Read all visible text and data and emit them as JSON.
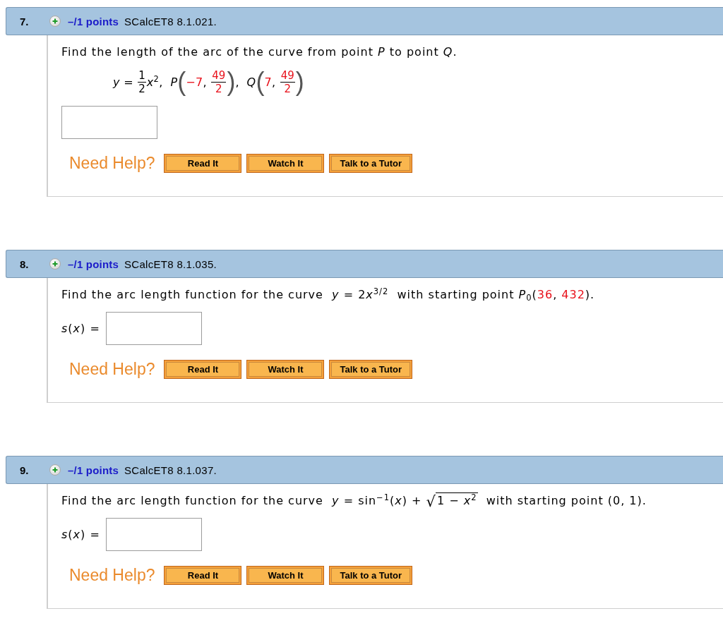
{
  "questions": [
    {
      "number": "7.",
      "points": "–/1 points",
      "source": "SCalcET8 8.1.021.",
      "prompt": [
        {
          "kind": "text",
          "text": "Find the length of the arc of the curve from point *P* to point *Q*."
        }
      ],
      "formula": [
        {
          "kind": "text",
          "text": "*y* = "
        },
        {
          "kind": "frac",
          "num": "1",
          "den": "2"
        },
        {
          "kind": "text",
          "text": "*x*$^{2}$,  *P*"
        },
        {
          "kind": "paren",
          "text": "("
        },
        {
          "kind": "given",
          "text": "−7"
        },
        {
          "kind": "text",
          "text": ", "
        },
        {
          "kind": "given_frac",
          "num": "49",
          "den": "2"
        },
        {
          "kind": "paren",
          "text": ")"
        },
        {
          "kind": "text",
          "text": ",  *Q*"
        },
        {
          "kind": "paren",
          "text": "("
        },
        {
          "kind": "given",
          "text": "7"
        },
        {
          "kind": "text",
          "text": ", "
        },
        {
          "kind": "given_frac",
          "num": "49",
          "den": "2"
        },
        {
          "kind": "paren",
          "text": ")"
        }
      ],
      "help_label": "Need Help?",
      "help_buttons": [
        "Read It",
        "Watch It",
        "Talk to a Tutor"
      ]
    },
    {
      "number": "8.",
      "points": "–/1 points",
      "source": "SCalcET8 8.1.035.",
      "prompt": [
        {
          "kind": "text",
          "text": "Find the arc length function for the curve  *y* = 2"
        },
        {
          "kind": "text",
          "text": "*x*$^{3/2}$  with starting point *P*$_{0}$("
        },
        {
          "kind": "given",
          "text": "36"
        },
        {
          "kind": "text",
          "text": ", "
        },
        {
          "kind": "given",
          "text": "432"
        },
        {
          "kind": "text",
          "text": ")."
        }
      ],
      "answer_label": "*s*(*x*) =",
      "help_label": "Need Help?",
      "help_buttons": [
        "Read It",
        "Watch It",
        "Talk to a Tutor"
      ]
    },
    {
      "number": "9.",
      "points": "–/1 points",
      "source": "SCalcET8 8.1.037.",
      "prompt": [
        {
          "kind": "text",
          "text": "Find the arc length function for the curve  *y* = sin$^{−1}$(*x*) + "
        },
        {
          "kind": "radical",
          "text": "√"
        },
        {
          "kind": "radicand",
          "text": "1 − *x*$^{2}$"
        },
        {
          "kind": "text",
          "text": "  with starting point (0, 1)."
        }
      ],
      "answer_label": "*s*(*x*) =",
      "help_label": "Need Help?",
      "help_buttons": [
        "Read It",
        "Watch It",
        "Talk to a Tutor"
      ]
    }
  ]
}
